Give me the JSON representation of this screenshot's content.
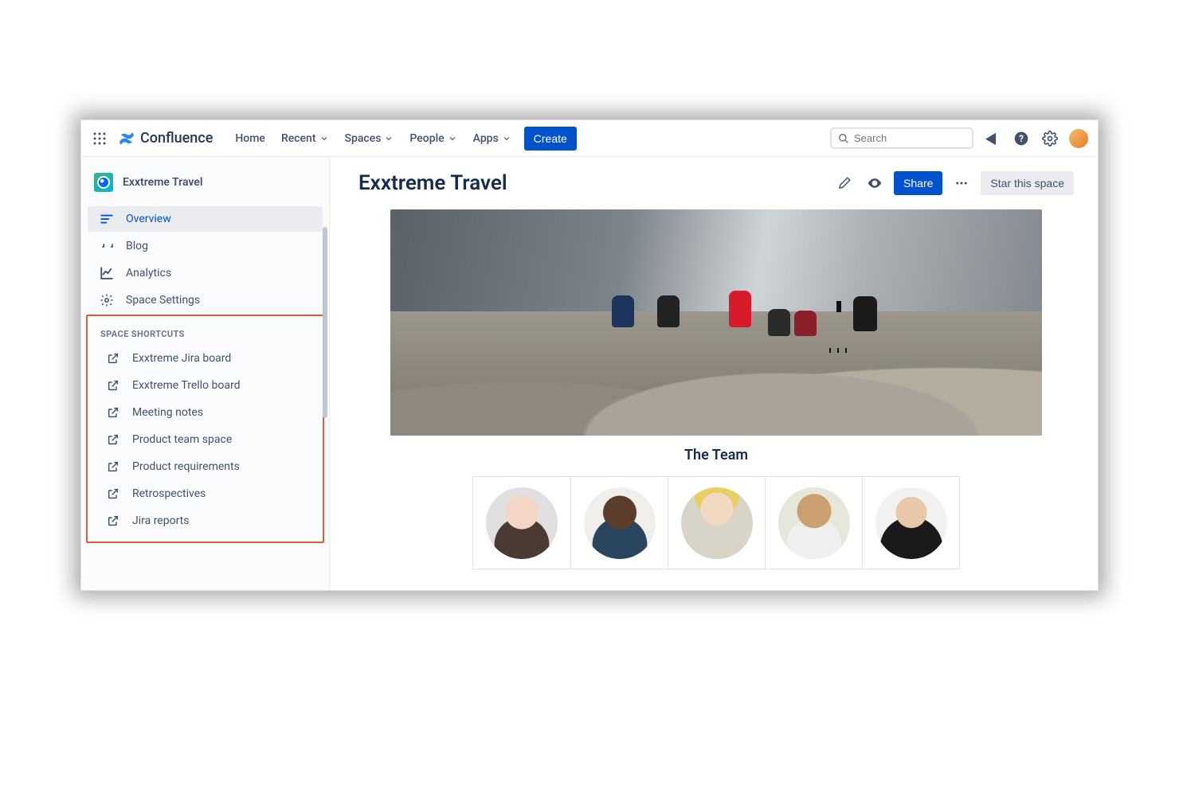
{
  "header": {
    "brand": "Confluence",
    "nav": {
      "home": "Home",
      "recent": "Recent",
      "spaces": "Spaces",
      "people": "People",
      "apps": "Apps"
    },
    "create": "Create",
    "search_placeholder": "Search"
  },
  "sidebar": {
    "space_name": "Exxtreme Travel",
    "items": [
      {
        "label": "Overview"
      },
      {
        "label": "Blog"
      },
      {
        "label": "Analytics"
      },
      {
        "label": "Space Settings"
      }
    ],
    "shortcuts_title": "SPACE SHORTCUTS",
    "shortcuts": [
      {
        "label": "Exxtreme Jira board"
      },
      {
        "label": "Exxtreme Trello board"
      },
      {
        "label": "Meeting notes"
      },
      {
        "label": "Product team space"
      },
      {
        "label": "Product requirements"
      },
      {
        "label": "Retrospectives"
      },
      {
        "label": "Jira reports"
      }
    ]
  },
  "page": {
    "title": "Exxtreme Travel",
    "share": "Share",
    "star": "Star this space",
    "team_heading": "The Team"
  }
}
